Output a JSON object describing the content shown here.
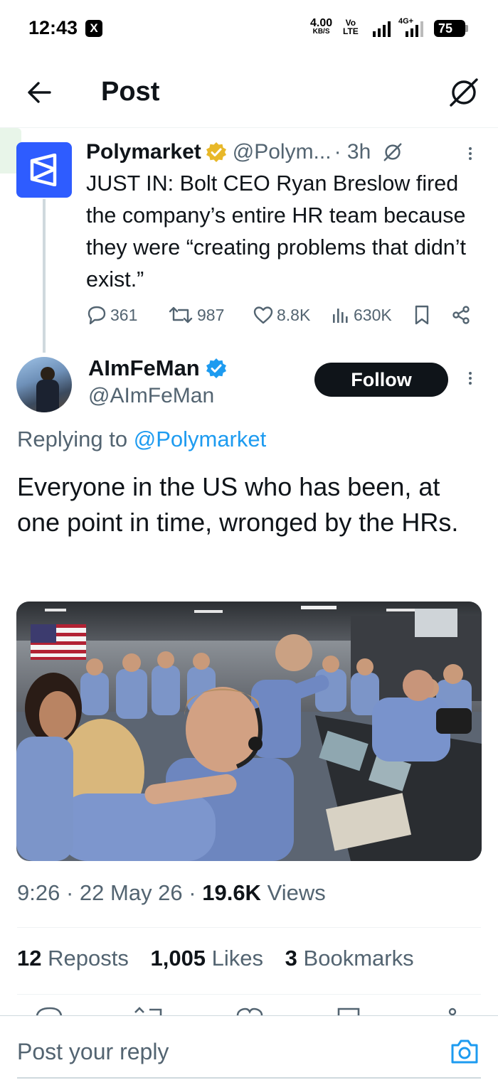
{
  "status_bar": {
    "time": "12:43",
    "x_app_glyph": "X",
    "net_speed": "4.00",
    "net_unit": "KB/S",
    "volte_top": "Vo",
    "volte_bottom": "LTE",
    "network": "4G+",
    "battery": "75"
  },
  "header": {
    "title": "Post",
    "back_icon": "arrow-left-icon",
    "grok_icon": "grok-icon"
  },
  "parent_tweet": {
    "author_name": "Polymarket",
    "handle": "@Polym...",
    "time": "· 3h",
    "text": "JUST IN: Bolt CEO Ryan Breslow fired the company’s entire HR team because they were “creating problems that didn’t exist.”",
    "replies": "361",
    "reposts": "987",
    "likes": "8.8K",
    "views": "630K",
    "brand_color": "#2e5cff"
  },
  "main_tweet": {
    "author_name": "AImFeMan",
    "handle": "@AImFeMan",
    "follow_label": "Follow",
    "replying_prefix": "Replying to",
    "replying_to": "@Polymarket",
    "text": "Everyone in the US who has been, at one point in time, wronged by the HRs.",
    "time": "9:26",
    "date": "· 22 May 26 ·",
    "views_count": "19.6K",
    "views_label": "Views",
    "reposts_count": "12",
    "reposts_label": "Reposts",
    "likes_count": "1,005",
    "likes_label": "Likes",
    "bookmarks_count": "3",
    "bookmarks_label": "Bookmarks"
  },
  "reply_bar": {
    "placeholder": "Post your reply"
  },
  "colors": {
    "accent": "#1d9bf0",
    "text_primary": "#0f1419",
    "text_secondary": "#536471",
    "verified_gold": "#e8b829",
    "verified_blue": "#1d9bf0"
  }
}
